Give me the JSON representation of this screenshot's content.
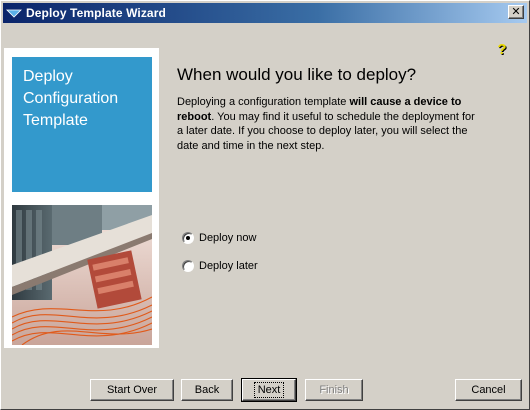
{
  "window": {
    "title": "Deploy Template Wizard",
    "close_label": "✕"
  },
  "sidebar": {
    "title": "Deploy Configuration Template"
  },
  "main": {
    "heading": "When would you like to deploy?",
    "description_part1": "Deploying a configuration template ",
    "description_bold": "will cause a device to reboot",
    "description_part2": ". You may find it useful to schedule the deployment for a later date. If you choose to deploy later, you will select the date and time in the next step."
  },
  "options": [
    {
      "label": "Deploy now",
      "selected": true
    },
    {
      "label": "Deploy later",
      "selected": false
    }
  ],
  "buttons": {
    "start_over": "Start Over",
    "back": "Back",
    "next": "Next",
    "finish": "Finish",
    "cancel": "Cancel"
  },
  "colors": {
    "sidebar_blue": "#3399cc",
    "title_bar_start": "#0a246a",
    "title_bar_end": "#a6caf0"
  }
}
